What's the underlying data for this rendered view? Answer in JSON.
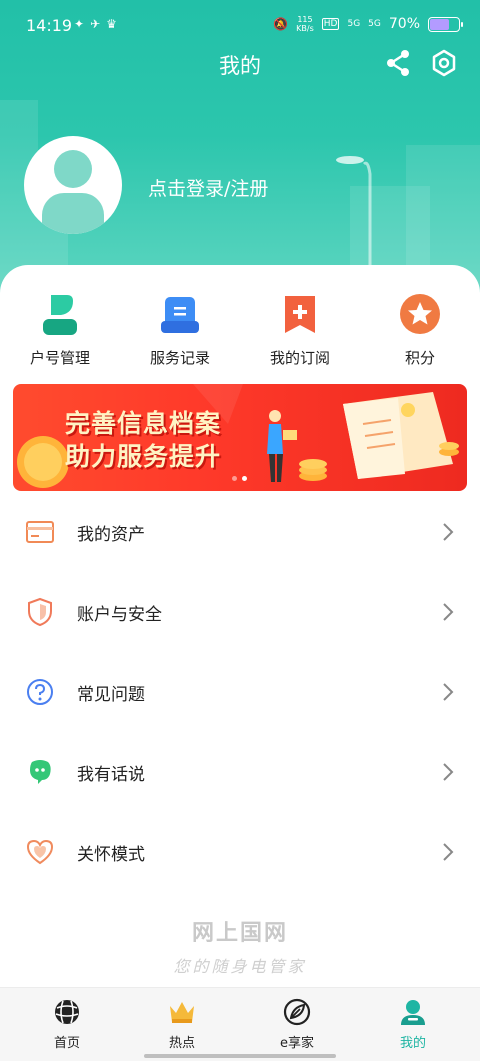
{
  "status_bar": {
    "time": "14:19",
    "net_speed_top": "115",
    "net_speed_unit": "KB/s",
    "hd": "HD",
    "sig1": "5G",
    "sig2": "5G",
    "battery": "70%",
    "battery_level": 0.7
  },
  "header": {
    "title": "我的",
    "login_text": "点击登录/注册",
    "accent": "#22c0a8"
  },
  "quick_actions": [
    {
      "label": "户号管理",
      "icon": "user-account-icon"
    },
    {
      "label": "服务记录",
      "icon": "service-record-icon"
    },
    {
      "label": "我的订阅",
      "icon": "subscription-icon"
    },
    {
      "label": "积分",
      "icon": "star-points-icon"
    }
  ],
  "banner": {
    "line1": "完善信息档案",
    "line2": "助力服务提升",
    "active_dot": 2,
    "dot_count": 2
  },
  "menu": [
    {
      "label": "我的资产",
      "icon": "card-icon"
    },
    {
      "label": "账户与安全",
      "icon": "shield-icon"
    },
    {
      "label": "常见问题",
      "icon": "question-icon"
    },
    {
      "label": "我有话说",
      "icon": "chat-icon"
    },
    {
      "label": "关怀模式",
      "icon": "heart-icon"
    }
  ],
  "footer": {
    "brand": "网上国网",
    "slogan": "您的随身电管家"
  },
  "tabbar": [
    {
      "label": "首页",
      "icon": "globe-icon",
      "active": false
    },
    {
      "label": "热点",
      "icon": "crown-icon",
      "active": false
    },
    {
      "label": "e享家",
      "icon": "leaf-icon",
      "active": false
    },
    {
      "label": "我的",
      "icon": "profile-icon",
      "active": true
    }
  ]
}
